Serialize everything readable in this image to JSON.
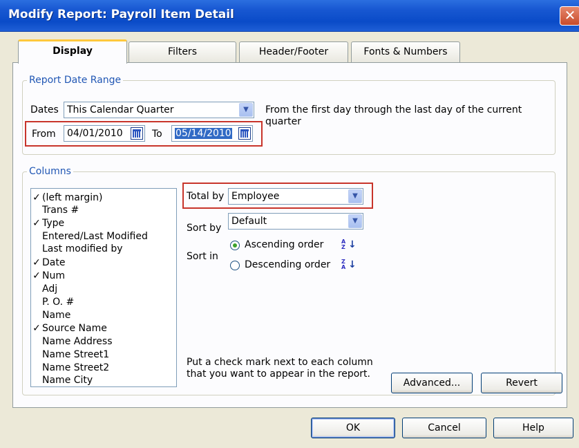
{
  "window": {
    "title": "Modify Report: Payroll Item Detail",
    "close_glyph": "✕"
  },
  "tabs": [
    {
      "label": "Display",
      "active": true
    },
    {
      "label": "Filters",
      "active": false
    },
    {
      "label": "Header/Footer",
      "active": false
    },
    {
      "label": "Fonts & Numbers",
      "active": false
    }
  ],
  "date_range": {
    "group_label": "Report Date Range",
    "dates_label": "Dates",
    "dates_value": "This Calendar Quarter",
    "description_line1": "From the first day through the last day of the current",
    "description_line2": "quarter",
    "from_label": "From",
    "from_value": "04/01/2010",
    "to_label": "To",
    "to_value": "05/14/2010"
  },
  "columns": {
    "group_label": "Columns",
    "items": [
      {
        "checked": true,
        "label": "(left margin)"
      },
      {
        "checked": false,
        "label": "Trans #"
      },
      {
        "checked": true,
        "label": "Type"
      },
      {
        "checked": false,
        "label": "Entered/Last Modified"
      },
      {
        "checked": false,
        "label": "Last modified by"
      },
      {
        "checked": true,
        "label": "Date"
      },
      {
        "checked": true,
        "label": "Num"
      },
      {
        "checked": false,
        "label": "Adj"
      },
      {
        "checked": false,
        "label": "P. O. #"
      },
      {
        "checked": false,
        "label": "Name"
      },
      {
        "checked": true,
        "label": "Source Name"
      },
      {
        "checked": false,
        "label": "Name Address"
      },
      {
        "checked": false,
        "label": "Name Street1"
      },
      {
        "checked": false,
        "label": "Name Street2"
      },
      {
        "checked": false,
        "label": "Name City"
      }
    ],
    "check_glyph": "✓",
    "total_by_label": "Total by",
    "total_by_value": "Employee",
    "sort_by_label": "Sort by",
    "sort_by_value": "Default",
    "sort_in_label": "Sort in",
    "ascending_label": "Ascending order",
    "descending_label": "Descending order",
    "sort_selected": "ascending",
    "hint_line1": "Put a check mark next to each column",
    "hint_line2": "that you want to appear in the report.",
    "advanced_label": "Advanced...",
    "revert_label": "Revert"
  },
  "footer": {
    "ok_label": "OK",
    "cancel_label": "Cancel",
    "help_label": "Help"
  },
  "icons": {
    "dropdown": "chevron-down-icon",
    "calendar": "calendar-icon",
    "sort_ascending": "sort-ascending-icon",
    "sort_descending": "sort-descending-icon"
  },
  "colors": {
    "titlebar": "#0A4BC8",
    "highlight_box": "#C8342A",
    "group_label": "#2157B4",
    "active_tab_accent": "#FFC83C"
  }
}
